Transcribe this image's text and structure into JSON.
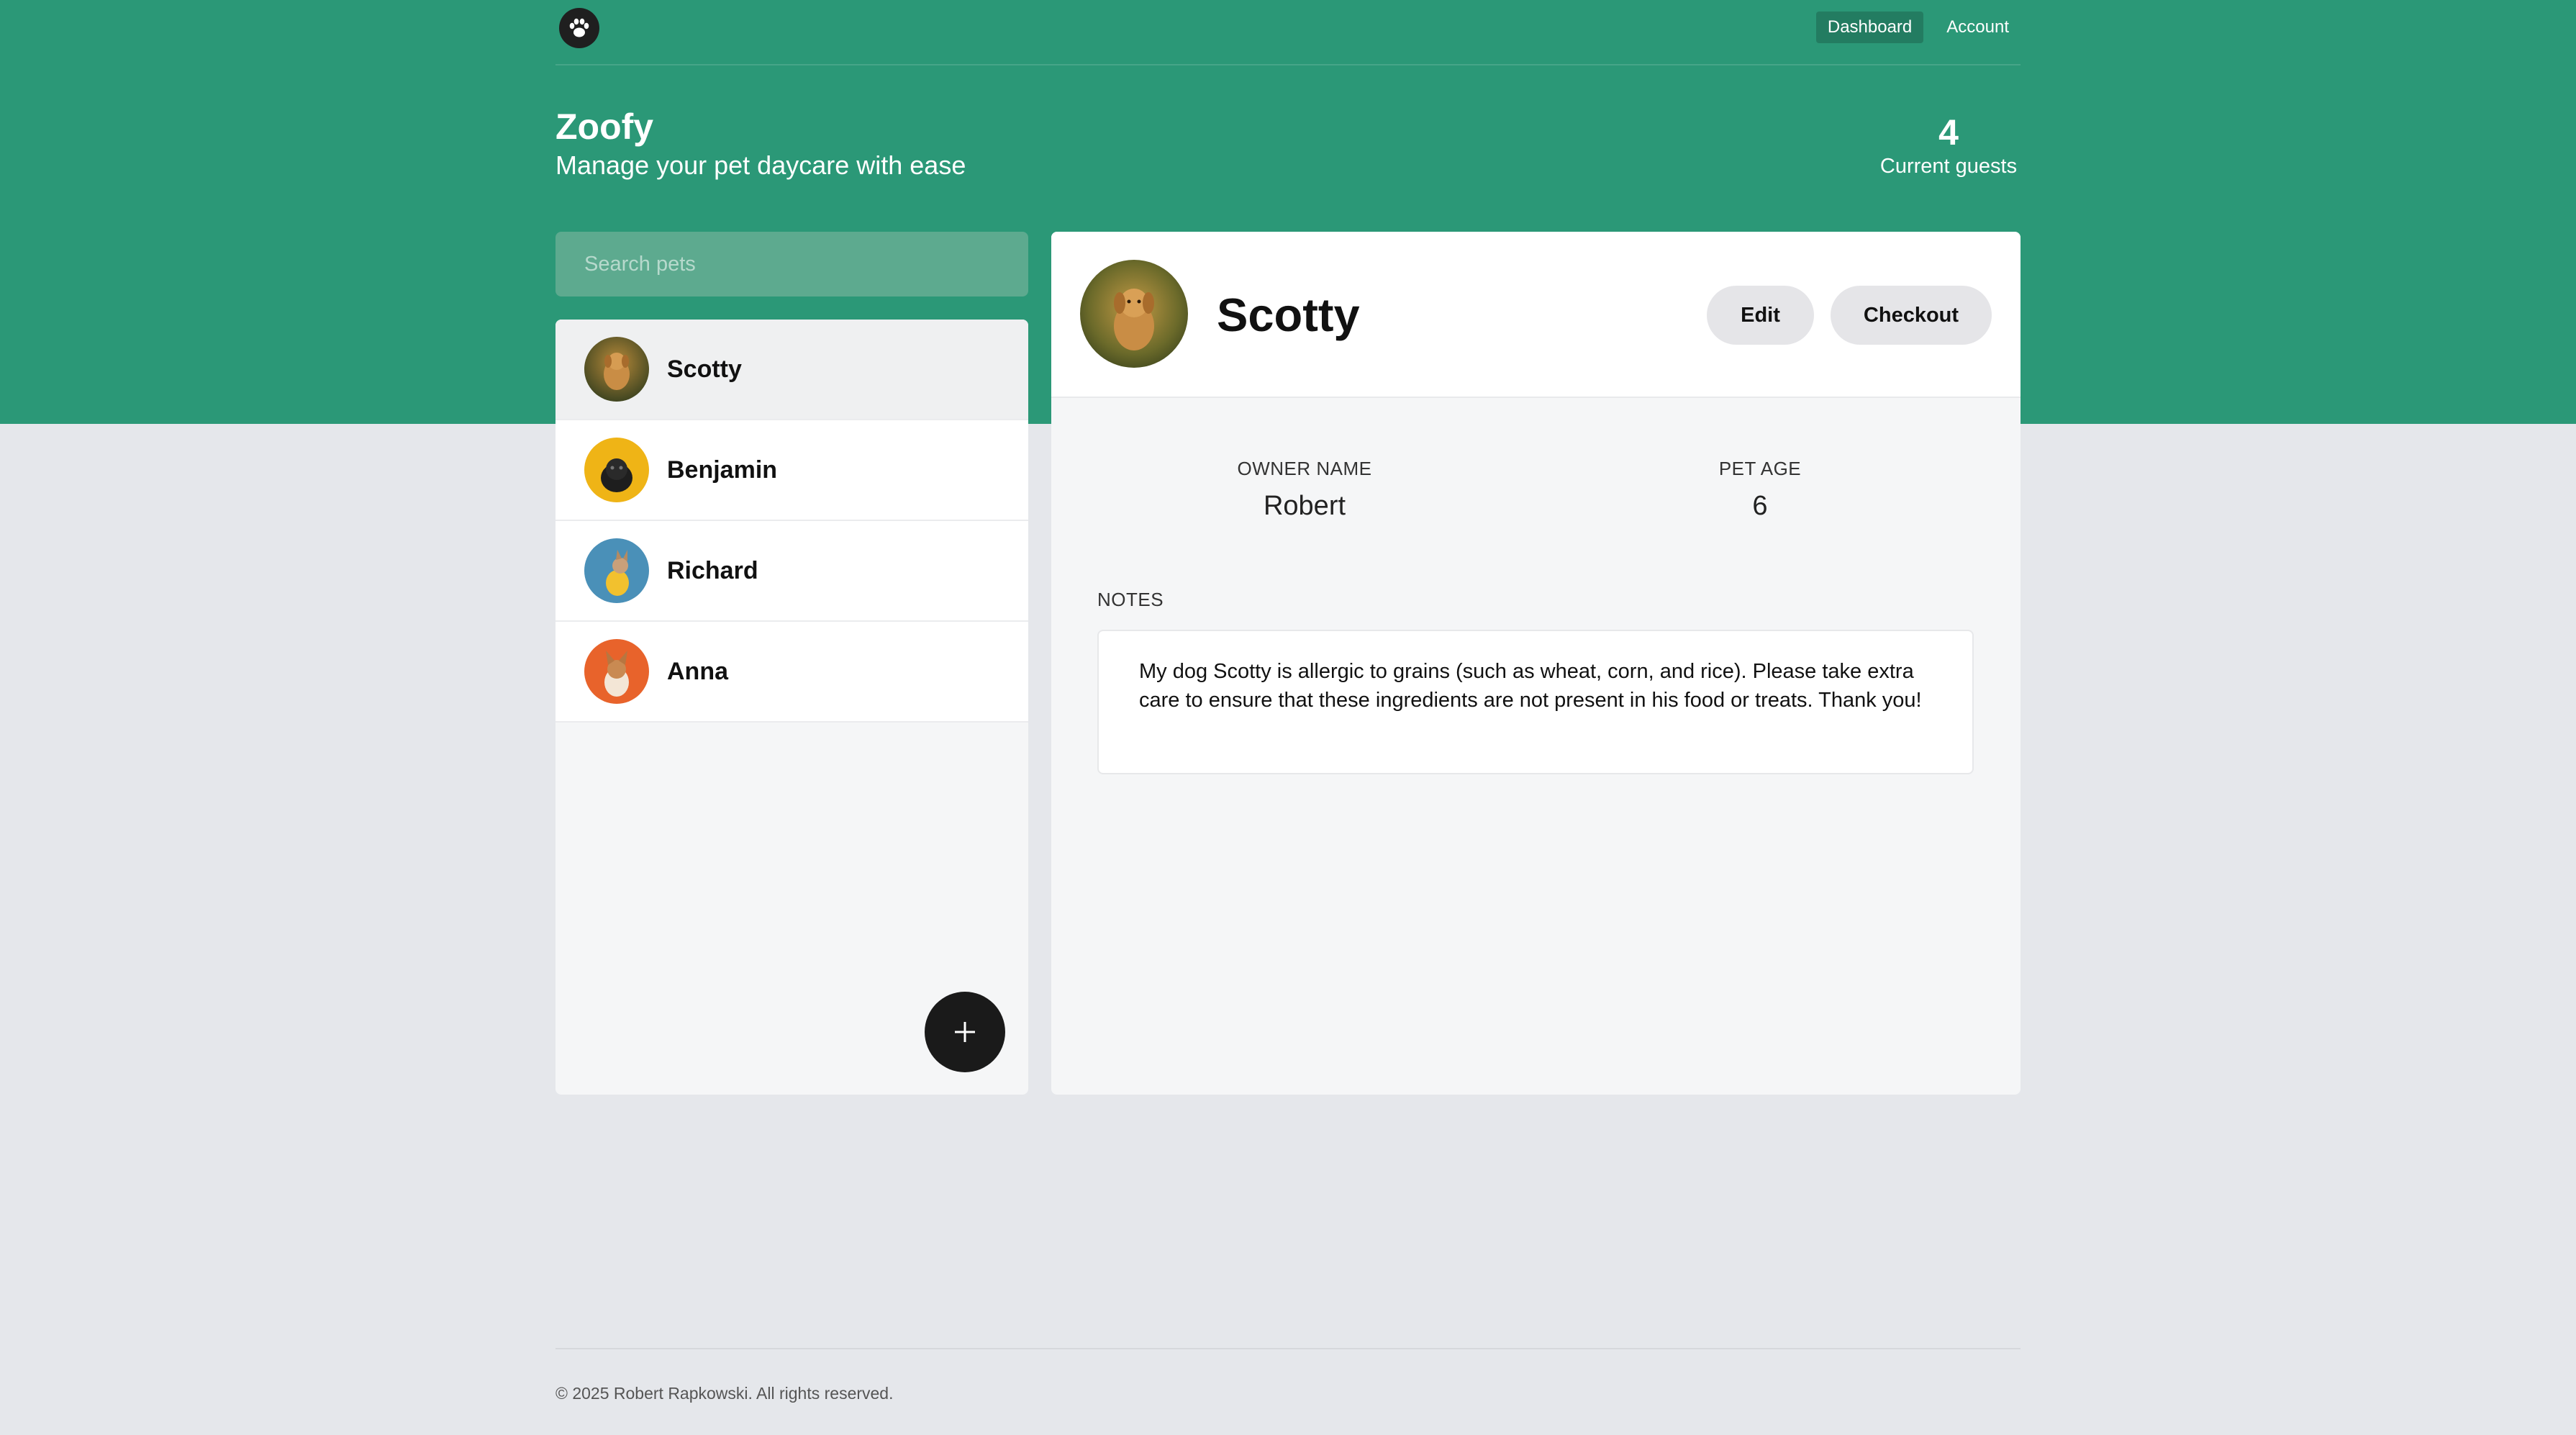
{
  "nav": {
    "logo": "paw-icon",
    "links": [
      {
        "label": "Dashboard",
        "active": true
      },
      {
        "label": "Account",
        "active": false
      }
    ]
  },
  "header": {
    "title": "Zoofy",
    "subtitle": "Manage your pet daycare with ease",
    "guest_count": "4",
    "guest_label": "Current guests"
  },
  "search": {
    "placeholder": "Search pets",
    "value": ""
  },
  "pets": [
    {
      "name": "Scotty",
      "selected": true
    },
    {
      "name": "Benjamin",
      "selected": false
    },
    {
      "name": "Richard",
      "selected": false
    },
    {
      "name": "Anna",
      "selected": false
    }
  ],
  "add_button": {
    "icon": "plus-icon"
  },
  "detail": {
    "name": "Scotty",
    "edit_label": "Edit",
    "checkout_label": "Checkout",
    "owner_label": "OWNER NAME",
    "owner_value": "Robert",
    "age_label": "PET AGE",
    "age_value": "6",
    "notes_label": "NOTES",
    "notes": "My dog Scotty is allergic to grains (such as wheat, corn, and rice). Please take extra care to ensure that these ingredients are not present in his food or treats. Thank you!"
  },
  "footer": {
    "copyright": "© 2025 Robert Rapkowski. All rights reserved."
  },
  "colors": {
    "brand_green": "#2b9877",
    "page_bg": "#e5e7eb",
    "dark": "#1a1a1a"
  }
}
